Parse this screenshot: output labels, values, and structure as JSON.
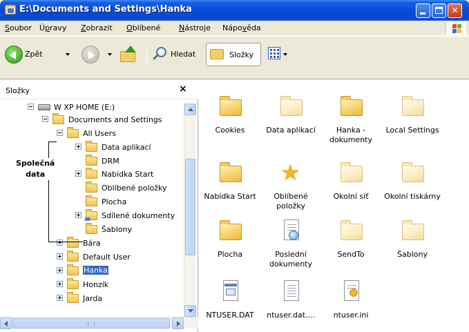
{
  "window": {
    "title": "E:\\Documents and Settings\\Hanka",
    "minimize_label": "",
    "maximize_label": "",
    "close_label": "✕"
  },
  "menu": {
    "items": [
      {
        "pre": "",
        "u": "S",
        "post": "oubor"
      },
      {
        "pre": "Ú",
        "u": "p",
        "post": "ravy"
      },
      {
        "pre": "",
        "u": "Z",
        "post": "obrazit"
      },
      {
        "pre": "",
        "u": "O",
        "post": "blíbené"
      },
      {
        "pre": "",
        "u": "N",
        "post": "ástroje"
      },
      {
        "pre": "Nápo",
        "u": "v",
        "post": "ěda"
      }
    ]
  },
  "toolbar": {
    "back_label": "Zpět",
    "search_label": "Hledat",
    "folders_label": "Složky"
  },
  "folders_pane": {
    "title": "Složky",
    "close": "×",
    "annotation": [
      "Společná",
      "data"
    ],
    "tree": [
      {
        "label": "W XP HOME (E:)",
        "expander": "minus",
        "icon": "drive"
      },
      {
        "label": "Documents and Settings",
        "expander": "minus",
        "icon": "folder"
      },
      {
        "label": "All Users",
        "expander": "minus",
        "icon": "folder"
      },
      {
        "label": "Data aplikací",
        "expander": "plus",
        "icon": "folder"
      },
      {
        "label": "DRM",
        "expander": "",
        "icon": "folder"
      },
      {
        "label": "Nabídka Start",
        "expander": "plus",
        "icon": "folder"
      },
      {
        "label": "Oblíbené položky",
        "expander": "",
        "icon": "folder"
      },
      {
        "label": "Plocha",
        "expander": "",
        "icon": "folder"
      },
      {
        "label": "Sdílené dokumenty",
        "expander": "plus",
        "icon": "shared-folder"
      },
      {
        "label": "Šablony",
        "expander": "",
        "icon": "folder"
      },
      {
        "label": "Bára",
        "expander": "plus",
        "icon": "folder"
      },
      {
        "label": "Default User",
        "expander": "plus",
        "icon": "folder"
      },
      {
        "label": "Hanka",
        "expander": "plus",
        "icon": "folder",
        "selected": true
      },
      {
        "label": "Honzík",
        "expander": "plus",
        "icon": "folder"
      },
      {
        "label": "Jarda",
        "expander": "plus",
        "icon": "folder"
      }
    ]
  },
  "content": {
    "items": [
      {
        "label": "Cookies",
        "icon": "folder"
      },
      {
        "label": "Data aplikací",
        "icon": "folder-pale"
      },
      {
        "label": "Hanka - dokumenty",
        "icon": "folder"
      },
      {
        "label": "Local Settings",
        "icon": "folder-pale"
      },
      {
        "label": "Nabídka Start",
        "icon": "folder"
      },
      {
        "label": "Oblíbené položky",
        "icon": "star"
      },
      {
        "label": "Okolní síť",
        "icon": "folder-pale"
      },
      {
        "label": "Okolní tiskárny",
        "icon": "folder-pale"
      },
      {
        "label": "Plocha",
        "icon": "folder"
      },
      {
        "label": "Poslední dokumenty",
        "icon": "recent"
      },
      {
        "label": "SendTo",
        "icon": "folder-pale"
      },
      {
        "label": "Šablony",
        "icon": "folder-pale"
      },
      {
        "label": "NTUSER.DAT",
        "icon": "dat-file"
      },
      {
        "label": "ntuser.dat....",
        "icon": "text-file"
      },
      {
        "label": "ntuser.ini",
        "icon": "ini-file"
      }
    ]
  }
}
